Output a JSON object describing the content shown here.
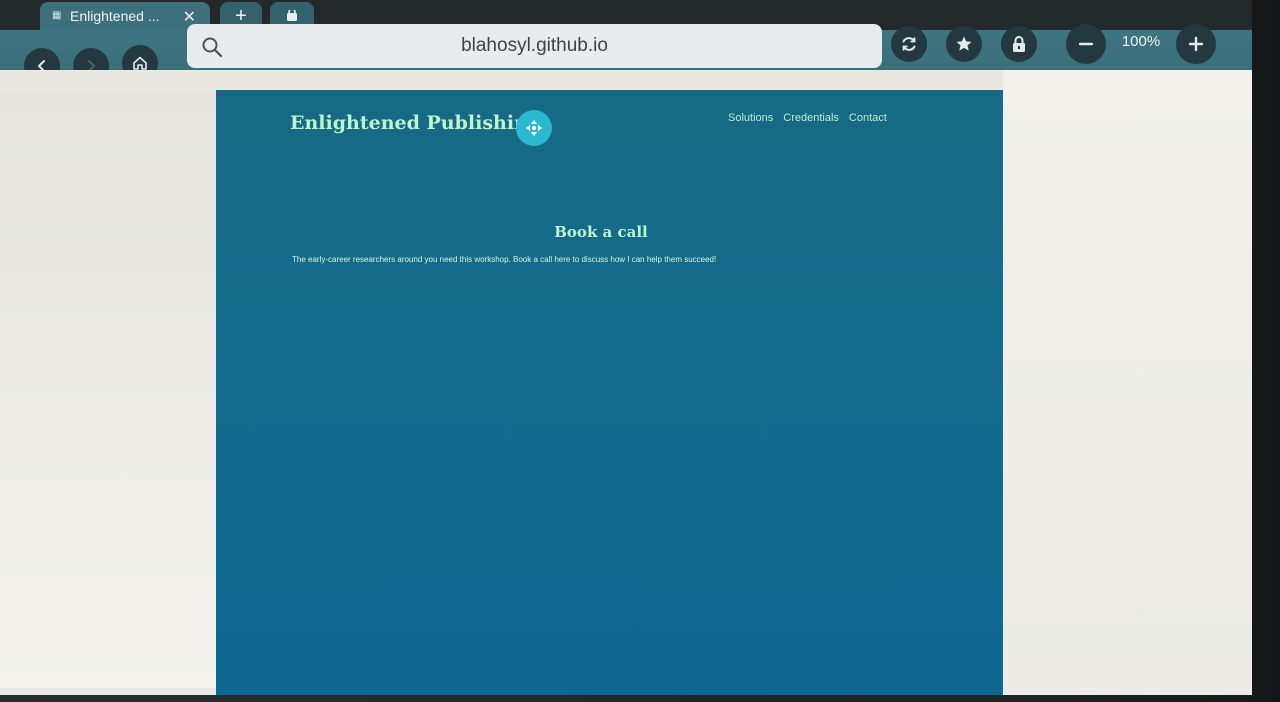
{
  "browser": {
    "tabs": [
      {
        "title": "Enlightened ...",
        "active": true
      },
      {
        "title": "+",
        "active": false
      }
    ],
    "address": "blahosyl.github.io",
    "zoom": "100%",
    "icons": {
      "back": "chevron-left-icon",
      "forward": "chevron-right-icon",
      "home": "home-icon",
      "reload": "reload-icon",
      "bookmark": "star-icon",
      "lock": "lock-icon",
      "zoom_out": "minus-icon",
      "zoom_in": "plus-icon"
    }
  },
  "site": {
    "logo": "Enlightened Publishing",
    "nav": [
      "Solutions",
      "Credentials",
      "Contact"
    ],
    "heading": "Book a call",
    "body": "The early-career researchers around you need this workshop. Book a call here to discuss how I can help them succeed!"
  },
  "colors": {
    "page_bg": "#126b8c",
    "accent_text": "#bdf5cf",
    "toolbar": "#3a6f7b",
    "handle": "#2bb8d0"
  }
}
